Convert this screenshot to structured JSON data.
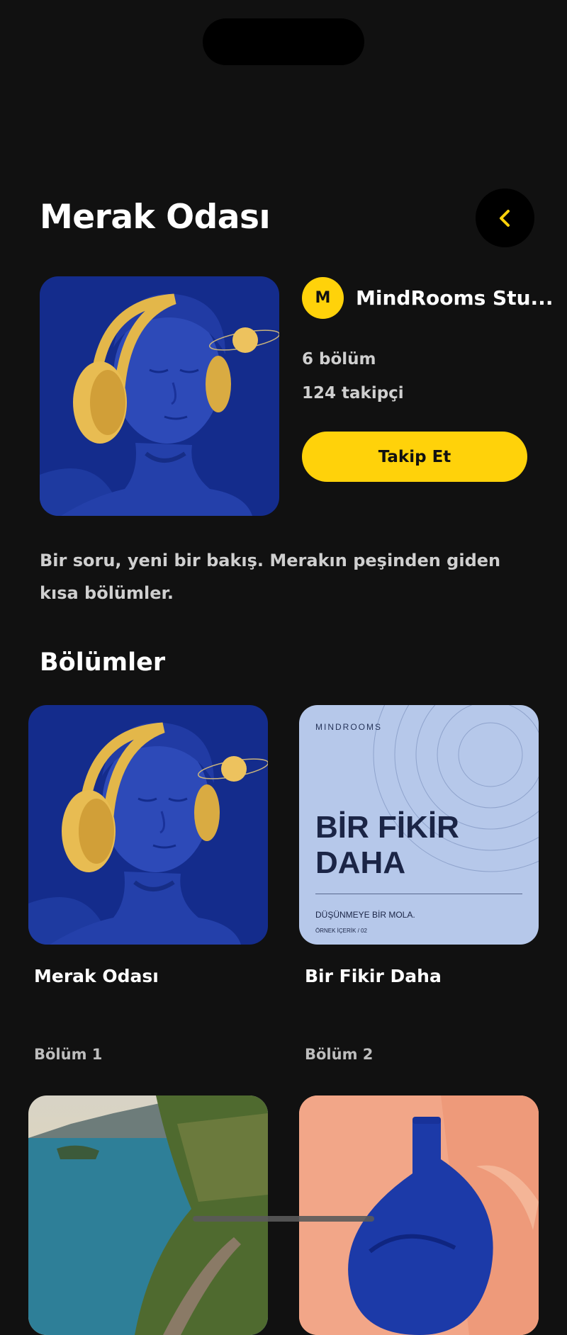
{
  "header": {
    "title": "Merak Odası",
    "back_icon": "chevron-left-icon"
  },
  "creator": {
    "avatar_letter": "M",
    "name": "MindRooms Stu..."
  },
  "stats": {
    "episodes": "6 bölüm",
    "followers": "124 takipçi"
  },
  "follow_button": {
    "label": "Takip Et"
  },
  "description": "Bir soru, yeni bir bakış. Merakın peşinden giden kısa bölümler.",
  "episodes_section": {
    "title": "Bölümler",
    "items": [
      {
        "title": "Merak Odası",
        "label": "Bölüm 1"
      },
      {
        "title": "Bir Fikir Daha",
        "label": "Bölüm 2",
        "cover_text": {
          "brand": "MINDROOMS",
          "headline_line1": "BİR FİKİR",
          "headline_line2": "DAHA",
          "subtitle": "DÜŞÜNMEYE BİR MOLA.",
          "tag": "ÖRNEK İÇERİK / 02"
        }
      }
    ]
  },
  "colors": {
    "background": "#111111",
    "accent": "#ffd20a",
    "card_blue_bg": "#122a8a",
    "card_light_blue": "#b6c8ea",
    "card_peach": "#f0a07e"
  }
}
